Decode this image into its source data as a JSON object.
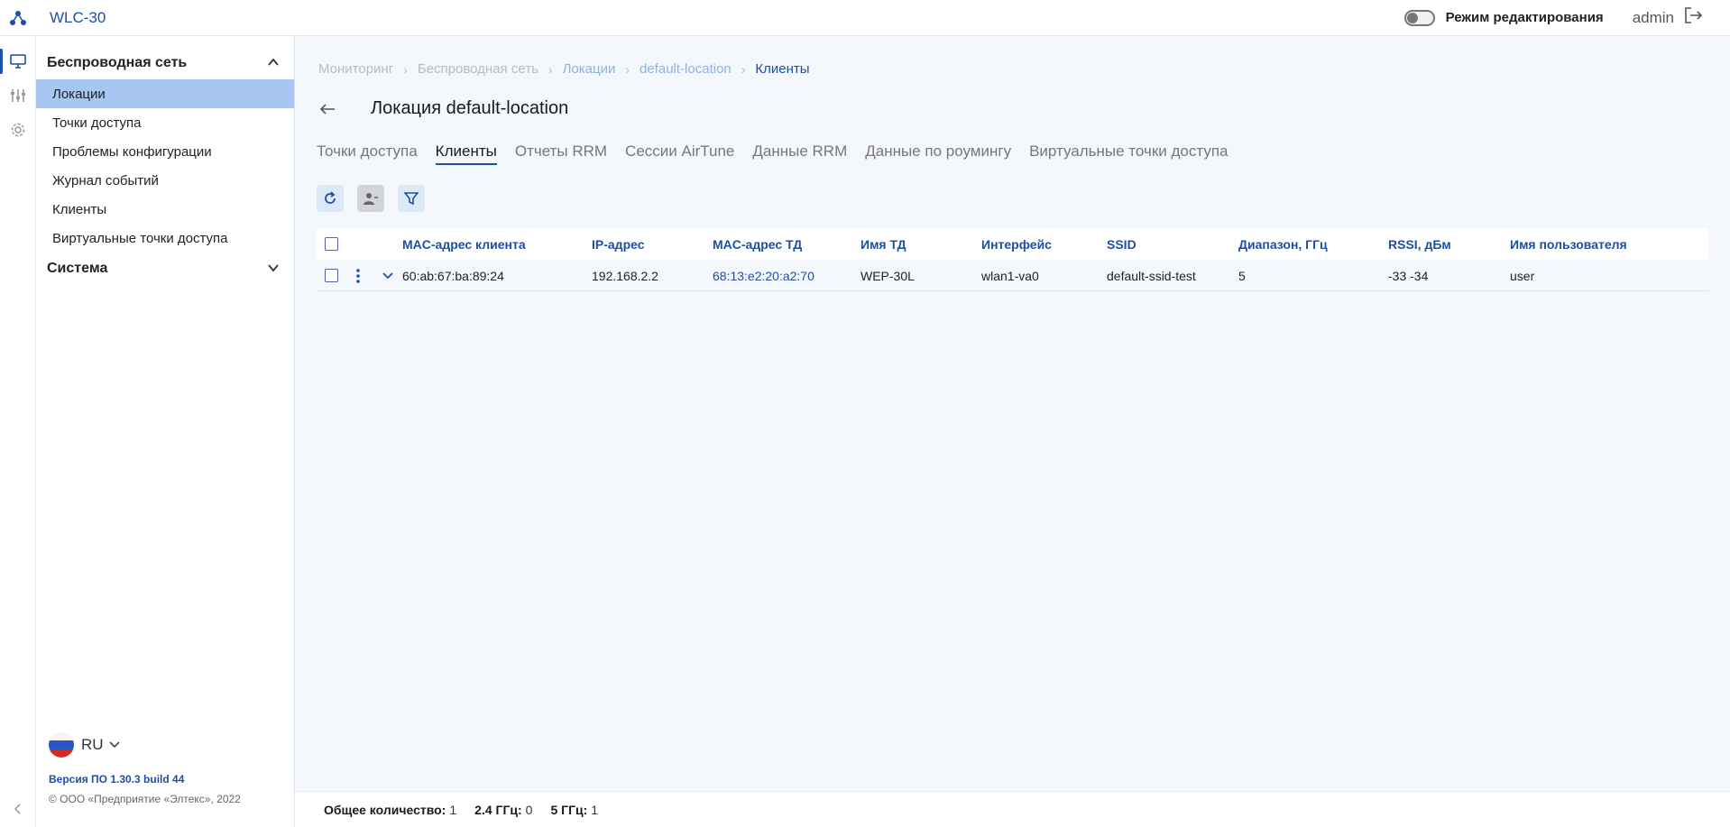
{
  "app": {
    "title": "WLC-30"
  },
  "topbar": {
    "edit_mode_label": "Режим редактирования",
    "edit_mode_on": false,
    "user": "admin"
  },
  "rail": {
    "items": [
      "monitor-icon",
      "settings-sliders-icon",
      "gear-icon"
    ]
  },
  "sidebar": {
    "sections": [
      {
        "title": "Беспроводная сеть",
        "expanded": true,
        "items": [
          {
            "label": "Локации",
            "active": true
          },
          {
            "label": "Точки доступа"
          },
          {
            "label": "Проблемы конфигурации"
          },
          {
            "label": "Журнал событий"
          },
          {
            "label": "Клиенты"
          },
          {
            "label": "Виртуальные точки доступа"
          }
        ]
      },
      {
        "title": "Система",
        "expanded": false
      }
    ],
    "language": "RU",
    "version": "Версия ПО 1.30.3 build 44",
    "copyright": "© ООО «Предприятие «Элтекс», 2022"
  },
  "breadcrumb": [
    "Мониторинг",
    "Беспроводная сеть",
    "Локации",
    "default-location",
    "Клиенты"
  ],
  "page": {
    "title": "Локация default-location"
  },
  "tabs": [
    {
      "label": "Точки доступа"
    },
    {
      "label": "Клиенты",
      "active": true
    },
    {
      "label": "Отчеты RRM"
    },
    {
      "label": "Сессии AirTune"
    },
    {
      "label": "Данные RRM"
    },
    {
      "label": "Данные по роумингу"
    },
    {
      "label": "Виртуальные точки доступа"
    }
  ],
  "table": {
    "columns": [
      "MAC-адрес клиента",
      "IP-адрес",
      "MAC-адрес ТД",
      "Имя ТД",
      "Интерфейс",
      "SSID",
      "Диапазон, ГГц",
      "RSSI, дБм",
      "Имя пользователя"
    ],
    "rows": [
      [
        "60:ab:67:ba:89:24",
        "192.168.2.2",
        "68:13:e2:20:a2:70",
        "WEP-30L",
        "wlan1-va0",
        "default-ssid-test",
        "5",
        "-33 -34",
        "user"
      ]
    ]
  },
  "footer": {
    "total_label": "Общее количество:",
    "total_value": "1",
    "band24_label": "2.4 ГГц:",
    "band24_value": "0",
    "band5_label": "5 ГГц:",
    "band5_value": "1"
  },
  "colors": {
    "accent": "#1c4fa8",
    "active_item": "#a8c6f2",
    "main_bg": "#f4f7fc"
  }
}
